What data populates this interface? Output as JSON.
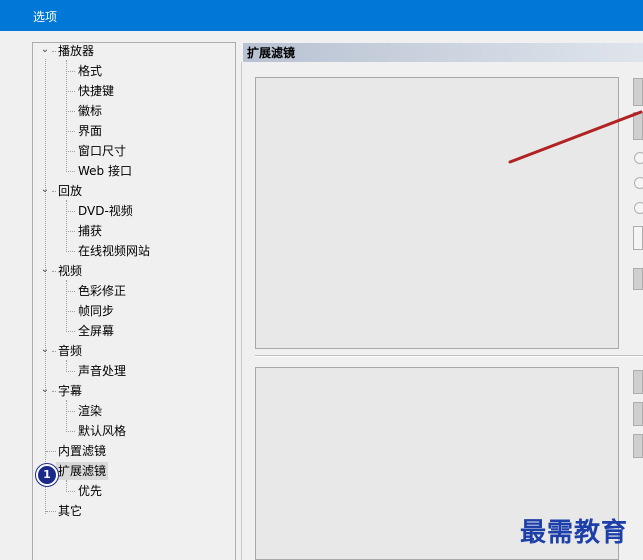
{
  "window": {
    "title": "选项"
  },
  "tree": {
    "items": [
      {
        "label": "播放器",
        "level": 0,
        "toggle": "⌄"
      },
      {
        "label": "格式",
        "level": 1
      },
      {
        "label": "快捷键",
        "level": 1
      },
      {
        "label": "徽标",
        "level": 1
      },
      {
        "label": "界面",
        "level": 1
      },
      {
        "label": "窗口尺寸",
        "level": 1
      },
      {
        "label": "Web 接口",
        "level": 1
      },
      {
        "label": "回放",
        "level": 0,
        "toggle": "⌄"
      },
      {
        "label": "DVD-视频",
        "level": 1
      },
      {
        "label": "捕获",
        "level": 1
      },
      {
        "label": "在线视频网站",
        "level": 1
      },
      {
        "label": "视频",
        "level": 0,
        "toggle": "⌄"
      },
      {
        "label": "色彩修正",
        "level": 1
      },
      {
        "label": "帧同步",
        "level": 1
      },
      {
        "label": "全屏幕",
        "level": 1
      },
      {
        "label": "音频",
        "level": 0,
        "toggle": "⌄"
      },
      {
        "label": "声音处理",
        "level": 1
      },
      {
        "label": "字幕",
        "level": 0,
        "toggle": "⌄"
      },
      {
        "label": "渲染",
        "level": 1
      },
      {
        "label": "默认风格",
        "level": 1
      },
      {
        "label": "内置滤镜",
        "level": 0
      },
      {
        "label": "扩展滤镜",
        "level": 0,
        "selected": true
      },
      {
        "label": "优先",
        "level": 1
      },
      {
        "label": "其它",
        "level": 0
      }
    ]
  },
  "annotation": {
    "badge": "1"
  },
  "panel": {
    "header": "扩展滤镜"
  },
  "watermark": "最需教育",
  "colors": {
    "titlebar": "#0078d7",
    "badge": "#1b2a8a",
    "arrow": "#b22222",
    "watermark": "#1c3faa"
  }
}
